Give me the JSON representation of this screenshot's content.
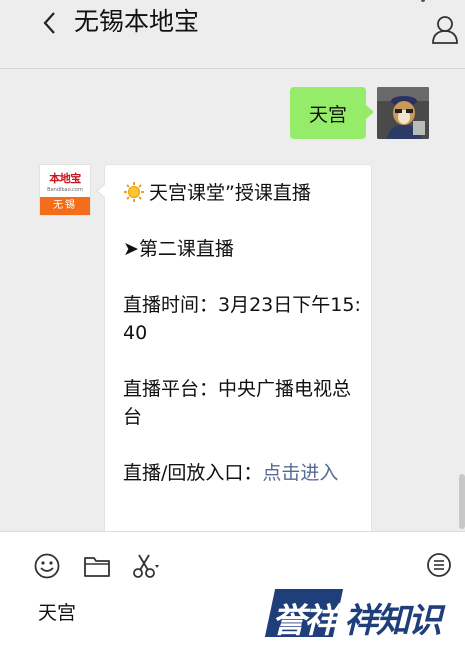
{
  "header": {
    "title": "无锡本地宝",
    "back_icon": "chevron-left-icon",
    "profile_icon": "person-icon"
  },
  "messages": {
    "outgoing": {
      "text": "天宫"
    },
    "incoming": {
      "avatar": {
        "logo_text": "本地宝",
        "logo_domain": "Bendibao.com",
        "city": "无锡"
      },
      "line1": "天宫课堂”授课直播",
      "line2": "➤第二课直播",
      "line3": "直播时间：3月23日下午15:40",
      "line4": "直播平台：中央广播电视总台",
      "line5_prefix": "直播/回放入口：",
      "line5_link": "点击进入"
    }
  },
  "input": {
    "value": "天宫",
    "icons": [
      "emoji-icon",
      "folder-icon",
      "scissors-icon",
      "chat-history-icon"
    ]
  },
  "watermark": {
    "part1": "誉祥",
    "part2": "祥知识"
  },
  "colors": {
    "outgoing_bubble": "#95ec69",
    "link": "#576b95",
    "brand_orange": "#f36d1a",
    "watermark_blue": "#1f3f7a"
  }
}
